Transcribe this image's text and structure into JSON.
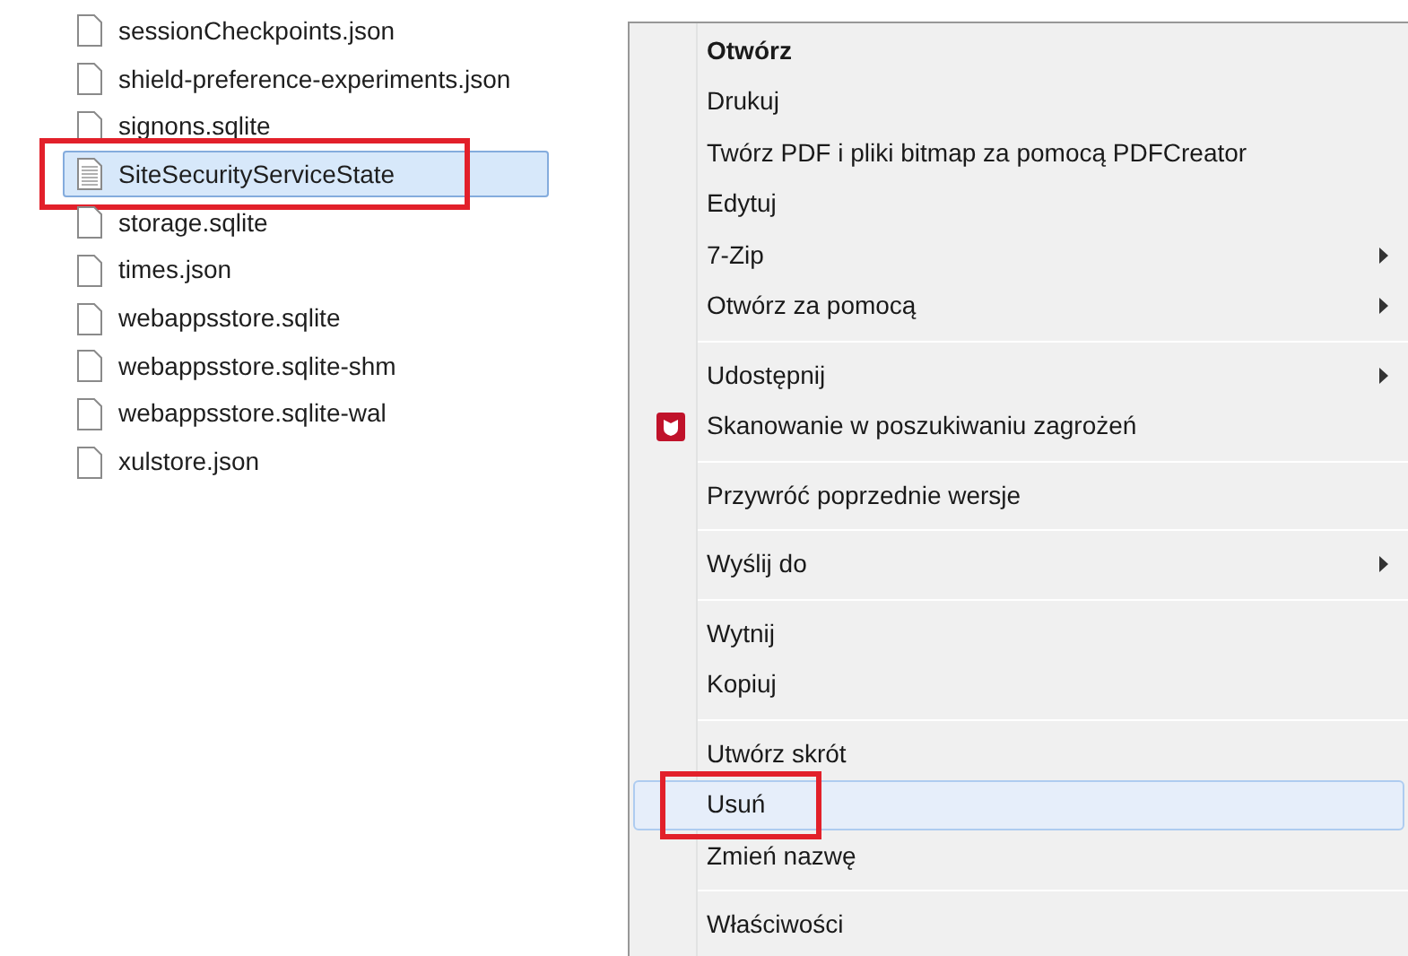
{
  "files": [
    {
      "name": "sessionCheckpoints.json",
      "selected": false,
      "annotated": false
    },
    {
      "name": "shield-preference-experiments.json",
      "selected": false,
      "annotated": false
    },
    {
      "name": "signons.sqlite",
      "selected": false,
      "annotated": false
    },
    {
      "name": "SiteSecurityServiceState",
      "selected": true,
      "annotated": true
    },
    {
      "name": "storage.sqlite",
      "selected": false,
      "annotated": false
    },
    {
      "name": "times.json",
      "selected": false,
      "annotated": false
    },
    {
      "name": "webappsstore.sqlite",
      "selected": false,
      "annotated": false
    },
    {
      "name": "webappsstore.sqlite-shm",
      "selected": false,
      "annotated": false
    },
    {
      "name": "webappsstore.sqlite-wal",
      "selected": false,
      "annotated": false
    },
    {
      "name": "xulstore.json",
      "selected": false,
      "annotated": false
    }
  ],
  "context_menu": {
    "groups": [
      [
        {
          "label": "Otwórz",
          "default": true,
          "submenu": false,
          "selected": false,
          "annotated": false,
          "kind": "plain"
        },
        {
          "label": "Drukuj",
          "default": false,
          "submenu": false,
          "selected": false,
          "annotated": false,
          "kind": "plain"
        },
        {
          "label": "Twórz PDF i pliki bitmap za pomocą PDFCreator",
          "default": false,
          "submenu": false,
          "selected": false,
          "annotated": false,
          "kind": "plain"
        },
        {
          "label": "Edytuj",
          "default": false,
          "submenu": false,
          "selected": false,
          "annotated": false,
          "kind": "plain"
        },
        {
          "label": "7-Zip",
          "default": false,
          "submenu": true,
          "selected": false,
          "annotated": false,
          "kind": "plain"
        },
        {
          "label": "Otwórz za pomocą",
          "default": false,
          "submenu": true,
          "selected": false,
          "annotated": false,
          "kind": "plain"
        }
      ],
      [
        {
          "label": "Udostępnij",
          "default": false,
          "submenu": true,
          "selected": false,
          "annotated": false,
          "kind": "plain"
        },
        {
          "label": "Skanowanie w poszukiwaniu zagrożeń",
          "default": false,
          "submenu": false,
          "selected": false,
          "annotated": false,
          "kind": "scanner"
        }
      ],
      [
        {
          "label": "Przywróć poprzednie wersje",
          "default": false,
          "submenu": false,
          "selected": false,
          "annotated": false,
          "kind": "plain"
        }
      ],
      [
        {
          "label": "Wyślij do",
          "default": false,
          "submenu": true,
          "selected": false,
          "annotated": false,
          "kind": "plain"
        }
      ],
      [
        {
          "label": "Wytnij",
          "default": false,
          "submenu": false,
          "selected": false,
          "annotated": false,
          "kind": "plain"
        },
        {
          "label": "Kopiuj",
          "default": false,
          "submenu": false,
          "selected": false,
          "annotated": false,
          "kind": "plain"
        }
      ],
      [
        {
          "label": "Utwórz skrót",
          "default": false,
          "submenu": false,
          "selected": false,
          "annotated": false,
          "kind": "plain"
        },
        {
          "label": "Usuń",
          "default": false,
          "submenu": false,
          "selected": true,
          "annotated": true,
          "kind": "plain"
        },
        {
          "label": "Zmień nazwę",
          "default": false,
          "submenu": false,
          "selected": false,
          "annotated": false,
          "kind": "plain"
        }
      ],
      [
        {
          "label": "Właściwości",
          "default": false,
          "submenu": false,
          "selected": false,
          "annotated": false,
          "kind": "plain"
        }
      ]
    ]
  }
}
